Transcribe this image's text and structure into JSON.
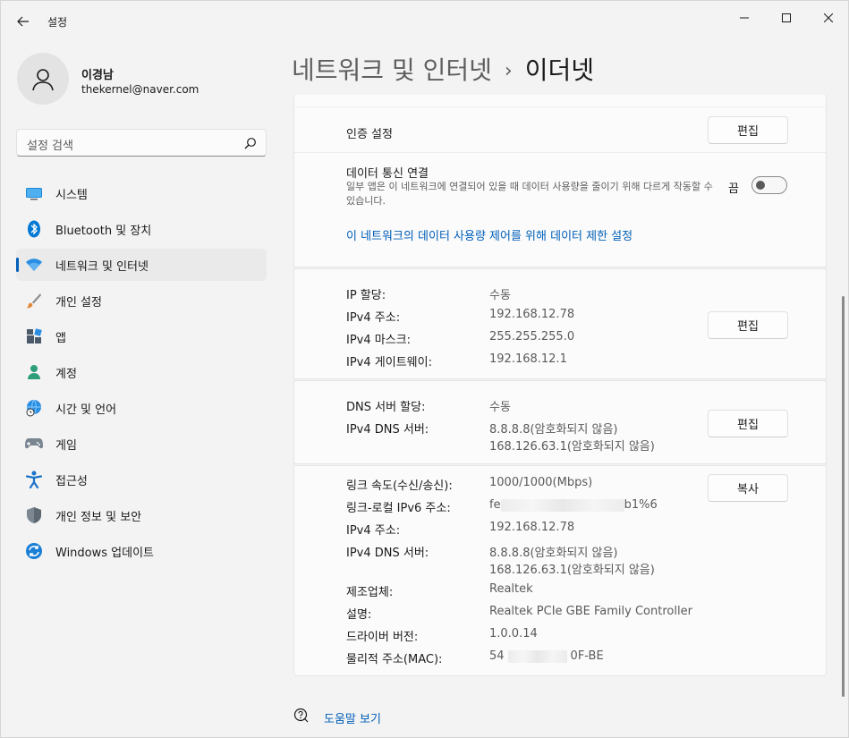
{
  "window": {
    "app_title": "설정"
  },
  "user": {
    "name": "이경남",
    "email": "thekernel@naver.com"
  },
  "search": {
    "placeholder": "설정 검색"
  },
  "sidebar": {
    "items": [
      {
        "label": "시스템",
        "icon": "monitor-icon"
      },
      {
        "label": "Bluetooth 및 장치",
        "icon": "bluetooth-icon"
      },
      {
        "label": "네트워크 및 인터넷",
        "icon": "wifi-icon",
        "active": true
      },
      {
        "label": "개인 설정",
        "icon": "brush-icon"
      },
      {
        "label": "앱",
        "icon": "apps-icon"
      },
      {
        "label": "계정",
        "icon": "person-icon"
      },
      {
        "label": "시간 및 언어",
        "icon": "globe-clock-icon"
      },
      {
        "label": "게임",
        "icon": "gamepad-icon"
      },
      {
        "label": "접근성",
        "icon": "accessibility-icon"
      },
      {
        "label": "개인 정보 및 보안",
        "icon": "shield-icon"
      },
      {
        "label": "Windows 업데이트",
        "icon": "update-icon"
      }
    ]
  },
  "breadcrumb": {
    "parent": "네트워크 및 인터넷",
    "separator": "›",
    "current": "이더넷"
  },
  "auth": {
    "label": "인증 설정",
    "button": "편집"
  },
  "metered": {
    "title": "데이터 통신 연결",
    "description": "일부 앱은 이 네트워크에 연결되어 있을 때 데이터 사용량을 줄이기 위해 다르게 작동할 수 있습니다.",
    "toggle_label": "끔",
    "toggle_on": false,
    "link": "이 네트워크의 데이터 사용량 제어를 위해 데이터 제한 설정"
  },
  "ip": {
    "rows": [
      {
        "label": "IP 할당:",
        "value": "수동"
      },
      {
        "label": "IPv4 주소:",
        "value": "192.168.12.78"
      },
      {
        "label": "IPv4 마스크:",
        "value": "255.255.255.0"
      },
      {
        "label": "IPv4 게이트웨이:",
        "value": "192.168.12.1"
      }
    ],
    "button": "편집"
  },
  "dns": {
    "assign_label": "DNS 서버 할당:",
    "assign_value": "수동",
    "server_label": "IPv4 DNS 서버:",
    "server_value_1": "8.8.8.8(암호화되지 않음)",
    "server_value_2": "168.126.63.1(암호화되지 않음)",
    "button": "편집"
  },
  "properties": {
    "button": "복사",
    "link_speed_label": "링크 속도(수신/송신):",
    "link_speed_value": "1000/1000(Mbps)",
    "ipv6_label": "링크-로컬 IPv6 주소:",
    "ipv6_prefix": "fe",
    "ipv6_suffix": "b1%6",
    "ipv4_label": "IPv4 주소:",
    "ipv4_value": "192.168.12.78",
    "dns_label": "IPv4 DNS 서버:",
    "dns_value_1": "8.8.8.8(암호화되지 않음)",
    "dns_value_2": "168.126.63.1(암호화되지 않음)",
    "vendor_label": "제조업체:",
    "vendor_value": "Realtek",
    "desc_label": "설명:",
    "desc_value": "Realtek PCIe GBE Family Controller",
    "driver_label": "드라이버 버전:",
    "driver_value": "1.0.0.14",
    "mac_label": "물리적 주소(MAC):",
    "mac_prefix": "54",
    "mac_suffix": "0F-BE"
  },
  "help": {
    "label": "도움말 보기"
  }
}
